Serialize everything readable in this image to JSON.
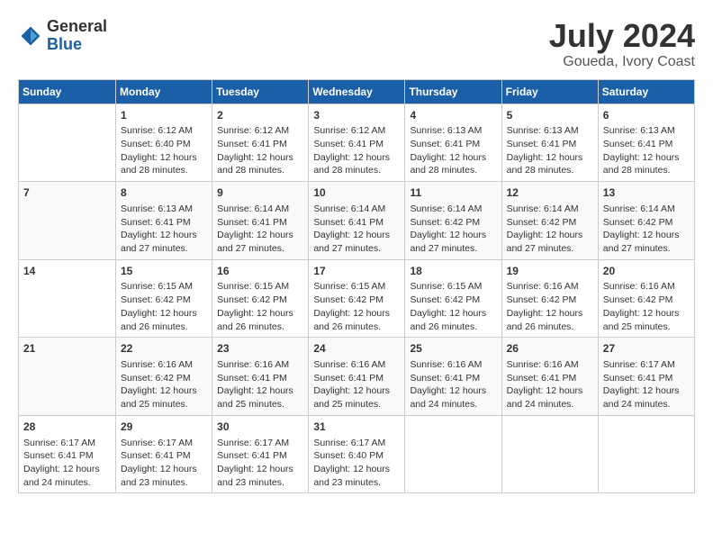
{
  "header": {
    "logo_general": "General",
    "logo_blue": "Blue",
    "month": "July 2024",
    "location": "Goueda, Ivory Coast"
  },
  "days_of_week": [
    "Sunday",
    "Monday",
    "Tuesday",
    "Wednesday",
    "Thursday",
    "Friday",
    "Saturday"
  ],
  "weeks": [
    [
      {
        "day": "",
        "info": ""
      },
      {
        "day": "1",
        "info": "Sunrise: 6:12 AM\nSunset: 6:40 PM\nDaylight: 12 hours\nand 28 minutes."
      },
      {
        "day": "2",
        "info": "Sunrise: 6:12 AM\nSunset: 6:41 PM\nDaylight: 12 hours\nand 28 minutes."
      },
      {
        "day": "3",
        "info": "Sunrise: 6:12 AM\nSunset: 6:41 PM\nDaylight: 12 hours\nand 28 minutes."
      },
      {
        "day": "4",
        "info": "Sunrise: 6:13 AM\nSunset: 6:41 PM\nDaylight: 12 hours\nand 28 minutes."
      },
      {
        "day": "5",
        "info": "Sunrise: 6:13 AM\nSunset: 6:41 PM\nDaylight: 12 hours\nand 28 minutes."
      },
      {
        "day": "6",
        "info": "Sunrise: 6:13 AM\nSunset: 6:41 PM\nDaylight: 12 hours\nand 28 minutes."
      }
    ],
    [
      {
        "day": "7",
        "info": ""
      },
      {
        "day": "8",
        "info": "Sunrise: 6:13 AM\nSunset: 6:41 PM\nDaylight: 12 hours\nand 27 minutes."
      },
      {
        "day": "9",
        "info": "Sunrise: 6:14 AM\nSunset: 6:41 PM\nDaylight: 12 hours\nand 27 minutes."
      },
      {
        "day": "10",
        "info": "Sunrise: 6:14 AM\nSunset: 6:41 PM\nDaylight: 12 hours\nand 27 minutes."
      },
      {
        "day": "11",
        "info": "Sunrise: 6:14 AM\nSunset: 6:42 PM\nDaylight: 12 hours\nand 27 minutes."
      },
      {
        "day": "12",
        "info": "Sunrise: 6:14 AM\nSunset: 6:42 PM\nDaylight: 12 hours\nand 27 minutes."
      },
      {
        "day": "13",
        "info": "Sunrise: 6:14 AM\nSunset: 6:42 PM\nDaylight: 12 hours\nand 27 minutes."
      }
    ],
    [
      {
        "day": "14",
        "info": ""
      },
      {
        "day": "15",
        "info": "Sunrise: 6:15 AM\nSunset: 6:42 PM\nDaylight: 12 hours\nand 26 minutes."
      },
      {
        "day": "16",
        "info": "Sunrise: 6:15 AM\nSunset: 6:42 PM\nDaylight: 12 hours\nand 26 minutes."
      },
      {
        "day": "17",
        "info": "Sunrise: 6:15 AM\nSunset: 6:42 PM\nDaylight: 12 hours\nand 26 minutes."
      },
      {
        "day": "18",
        "info": "Sunrise: 6:15 AM\nSunset: 6:42 PM\nDaylight: 12 hours\nand 26 minutes."
      },
      {
        "day": "19",
        "info": "Sunrise: 6:16 AM\nSunset: 6:42 PM\nDaylight: 12 hours\nand 26 minutes."
      },
      {
        "day": "20",
        "info": "Sunrise: 6:16 AM\nSunset: 6:42 PM\nDaylight: 12 hours\nand 25 minutes."
      }
    ],
    [
      {
        "day": "21",
        "info": ""
      },
      {
        "day": "22",
        "info": "Sunrise: 6:16 AM\nSunset: 6:42 PM\nDaylight: 12 hours\nand 25 minutes."
      },
      {
        "day": "23",
        "info": "Sunrise: 6:16 AM\nSunset: 6:41 PM\nDaylight: 12 hours\nand 25 minutes."
      },
      {
        "day": "24",
        "info": "Sunrise: 6:16 AM\nSunset: 6:41 PM\nDaylight: 12 hours\nand 25 minutes."
      },
      {
        "day": "25",
        "info": "Sunrise: 6:16 AM\nSunset: 6:41 PM\nDaylight: 12 hours\nand 24 minutes."
      },
      {
        "day": "26",
        "info": "Sunrise: 6:16 AM\nSunset: 6:41 PM\nDaylight: 12 hours\nand 24 minutes."
      },
      {
        "day": "27",
        "info": "Sunrise: 6:17 AM\nSunset: 6:41 PM\nDaylight: 12 hours\nand 24 minutes."
      }
    ],
    [
      {
        "day": "28",
        "info": "Sunrise: 6:17 AM\nSunset: 6:41 PM\nDaylight: 12 hours\nand 24 minutes."
      },
      {
        "day": "29",
        "info": "Sunrise: 6:17 AM\nSunset: 6:41 PM\nDaylight: 12 hours\nand 23 minutes."
      },
      {
        "day": "30",
        "info": "Sunrise: 6:17 AM\nSunset: 6:41 PM\nDaylight: 12 hours\nand 23 minutes."
      },
      {
        "day": "31",
        "info": "Sunrise: 6:17 AM\nSunset: 6:40 PM\nDaylight: 12 hours\nand 23 minutes."
      },
      {
        "day": "",
        "info": ""
      },
      {
        "day": "",
        "info": ""
      },
      {
        "day": "",
        "info": ""
      }
    ]
  ]
}
